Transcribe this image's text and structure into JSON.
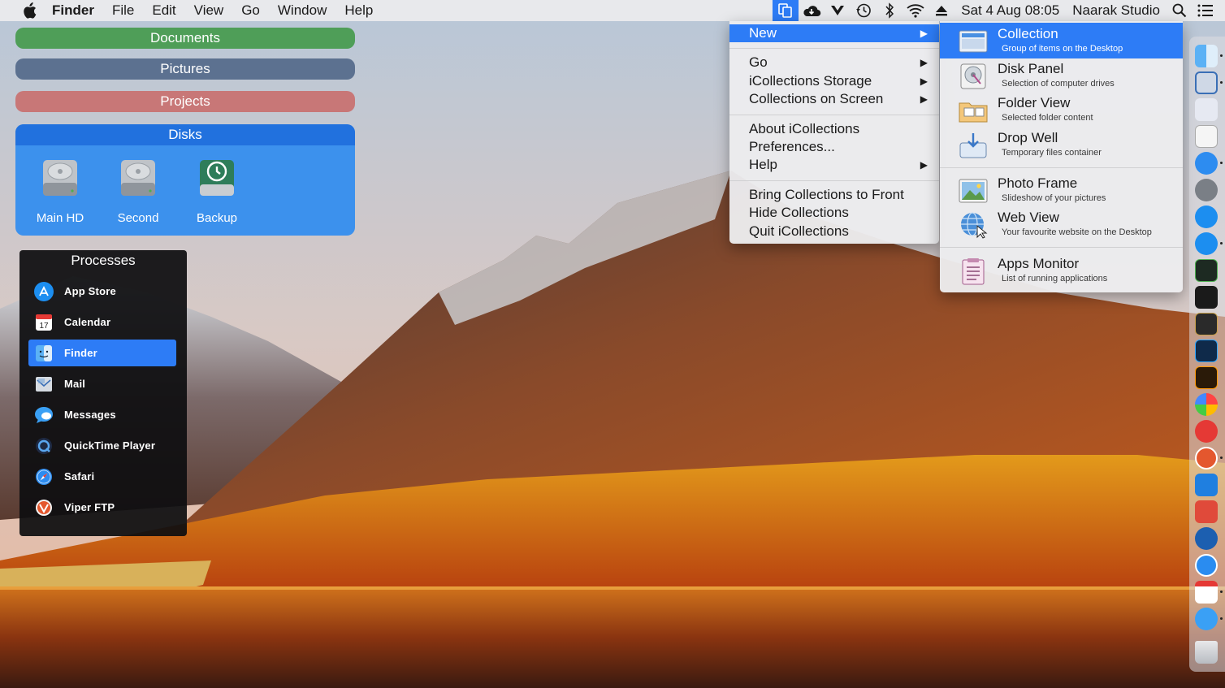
{
  "menubar": {
    "app_name": "Finder",
    "menus": [
      "File",
      "Edit",
      "View",
      "Go",
      "Window",
      "Help"
    ],
    "clock": "Sat 4 Aug  08:05",
    "user": "Naarak Studio",
    "status_icons": [
      "icollections-icon",
      "cloud-icon",
      "viper-icon",
      "time-machine-icon",
      "bluetooth-icon",
      "wifi-icon",
      "eject-icon"
    ]
  },
  "collections": {
    "documents": "Documents",
    "pictures": "Pictures",
    "projects": "Projects",
    "disks_title": "Disks",
    "disks": [
      {
        "label": "Main HD",
        "icon": "hard-drive-icon"
      },
      {
        "label": "Second",
        "icon": "hard-drive-icon"
      },
      {
        "label": "Backup",
        "icon": "time-machine-drive-icon"
      }
    ]
  },
  "processes": {
    "title": "Processes",
    "items": [
      {
        "label": "App Store",
        "icon": "app-store-icon"
      },
      {
        "label": "Calendar",
        "icon": "calendar-icon"
      },
      {
        "label": "Finder",
        "icon": "finder-icon",
        "selected": true
      },
      {
        "label": "Mail",
        "icon": "mail-icon"
      },
      {
        "label": "Messages",
        "icon": "messages-icon"
      },
      {
        "label": "QuickTime Player",
        "icon": "quicktime-icon"
      },
      {
        "label": "Safari",
        "icon": "safari-icon"
      },
      {
        "label": "Viper FTP",
        "icon": "viper-ftp-icon"
      }
    ]
  },
  "dropdown": {
    "new": "New",
    "go": "Go",
    "storage": "iCollections Storage",
    "on_screen": "Collections on Screen",
    "about": "About iCollections",
    "preferences": "Preferences...",
    "help": "Help",
    "bring_front": "Bring Collections to Front",
    "hide": "Hide Collections",
    "quit": "Quit iCollections"
  },
  "submenu": {
    "items": [
      {
        "title": "Collection",
        "subtitle": "Group of items on the Desktop",
        "icon": "collection-icon"
      },
      {
        "title": "Disk Panel",
        "subtitle": "Selection of computer drives",
        "icon": "disk-panel-icon"
      },
      {
        "title": "Folder View",
        "subtitle": "Selected folder content",
        "icon": "folder-view-icon"
      },
      {
        "title": "Drop Well",
        "subtitle": "Temporary files container",
        "icon": "drop-well-icon"
      },
      {
        "title": "Photo Frame",
        "subtitle": "Slideshow of your pictures",
        "icon": "photo-frame-icon"
      },
      {
        "title": "Web View",
        "subtitle": "Your favourite website on the Desktop",
        "icon": "web-view-icon"
      },
      {
        "title": "Apps Monitor",
        "subtitle": "List of running applications",
        "icon": "apps-monitor-icon"
      }
    ]
  },
  "dock": {
    "icons": [
      "finder-icon",
      "mail-icon",
      "preview-icon",
      "textedit-icon",
      "safari-icon",
      "system-preferences-icon",
      "cloud-icon",
      "app-store-icon",
      "activity-monitor-icon",
      "terminal-icon",
      "console-icon",
      "photoshop-icon",
      "illustrator-icon",
      "photos-icon",
      "rapidweaver-icon",
      "viper-ftp-icon",
      "xcode-icon",
      "screens-icon",
      "transmit-icon",
      "teamviewer-icon",
      "calendar-icon",
      "messages-icon",
      "trash-icon"
    ]
  },
  "colors": {
    "accent": "#2d7cf6",
    "documents": "#4f9e58",
    "pictures": "#5c7190",
    "projects": "#c87777",
    "disks": "#308cf0"
  }
}
